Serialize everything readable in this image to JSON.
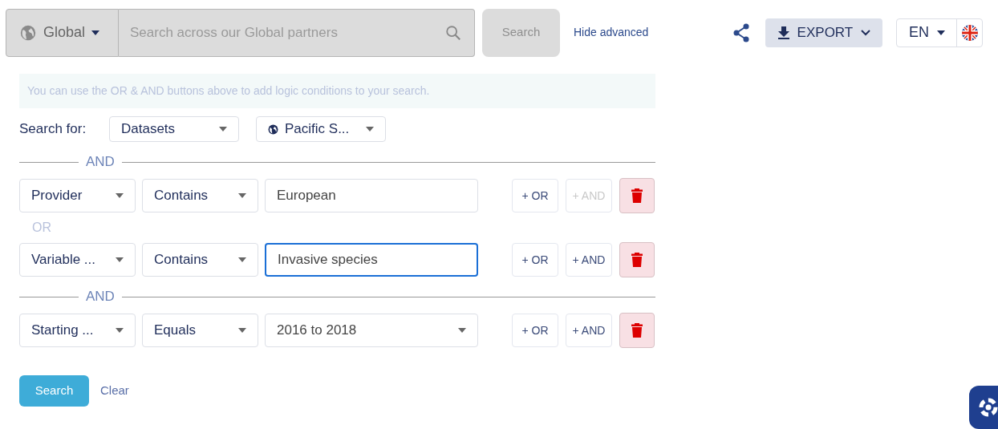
{
  "scope": {
    "label": "Global"
  },
  "search": {
    "placeholder": "Search across our Global partners",
    "button": "Search",
    "disabled": true
  },
  "hide_advanced": "Hide advanced",
  "export": "EXPORT",
  "language": "EN",
  "hint": "You can use the OR & AND buttons above to add logic conditions to your search.",
  "search_for": {
    "label": "Search for:",
    "type": "Datasets",
    "region": "Pacific S..."
  },
  "conditions": [
    {
      "connector": {
        "label": "AND",
        "kind": "divider"
      },
      "field": "Provider",
      "operator": "Contains",
      "kind": "text",
      "value": "European",
      "focused": false,
      "or_label": "+ OR",
      "and_label": "+ AND",
      "and_disabled": true
    },
    {
      "connector": {
        "label": "OR",
        "kind": "plain"
      },
      "field": "Variable ...",
      "operator": "Contains",
      "kind": "text",
      "value": "Invasive species",
      "focused": true,
      "or_label": "+ OR",
      "and_label": "+ AND",
      "and_disabled": false
    },
    {
      "connector": {
        "label": "AND",
        "kind": "divider"
      },
      "field": "Starting ...",
      "operator": "Equals",
      "kind": "select",
      "value": "2016 to 2018",
      "focused": false,
      "or_label": "+ OR",
      "and_label": "+ AND",
      "and_disabled": false
    }
  ],
  "actions": {
    "search": "Search",
    "clear": "Clear"
  }
}
